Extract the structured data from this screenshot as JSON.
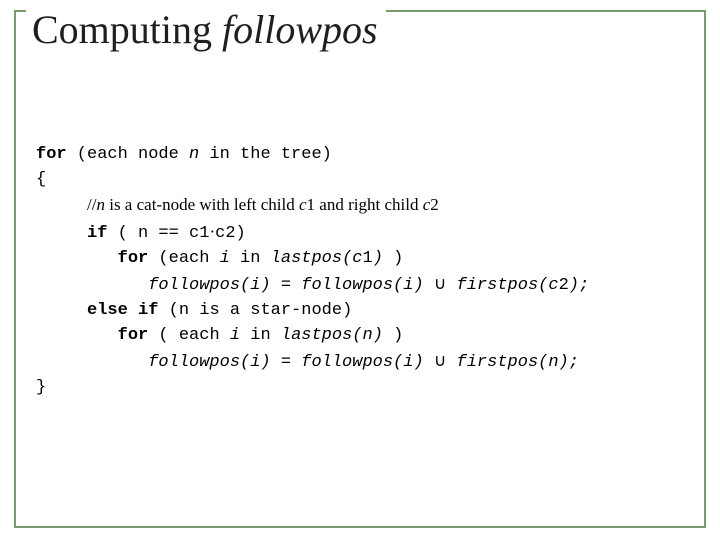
{
  "title": {
    "prefix": "Computing ",
    "em": "followpos"
  },
  "code": {
    "l1_a": "for",
    "l1_b": " (each node ",
    "l1_c": "n",
    "l1_d": " in the tree) ",
    "l2": "{",
    "l3_a": "     ",
    "l3_b": "//",
    "l3_c": "n",
    "l3_d": " is a cat-node with left child ",
    "l3_e": "c",
    "l3_f": "1 and right child ",
    "l3_g": "c",
    "l3_h": "2",
    "l4_a": "     ",
    "l4_b": "if",
    "l4_c": " ( n == c1",
    "l4_d": "·",
    "l4_e": "c2)",
    "l5_a": "        ",
    "l5_b": "for",
    "l5_c": " (each ",
    "l5_d": "i",
    "l5_e": " in ",
    "l5_f": "lastpos(c",
    "l5_g": "1",
    "l5_h": ")",
    "l5_i": " )",
    "l6_a": "           ",
    "l6_b": "followpos(i) = followpos(i)",
    "l6_c": " ",
    "l6_d": "∪",
    "l6_e": " ",
    "l6_f": "firstpos(c",
    "l6_g": "2",
    "l6_h": ");",
    "l7_a": "     ",
    "l7_b": "else if ",
    "l7_c": "(n is a star-node)",
    "l8_a": "        ",
    "l8_b": "for",
    "l8_c": " ( each ",
    "l8_d": "i",
    "l8_e": " in ",
    "l8_f": "lastpos(n)",
    "l8_g": " )",
    "l9_a": "           ",
    "l9_b": "followpos(i) = followpos(i)",
    "l9_c": " ",
    "l9_d": "∪",
    "l9_e": " ",
    "l9_f": "firstpos(n);",
    "l10": "}"
  }
}
